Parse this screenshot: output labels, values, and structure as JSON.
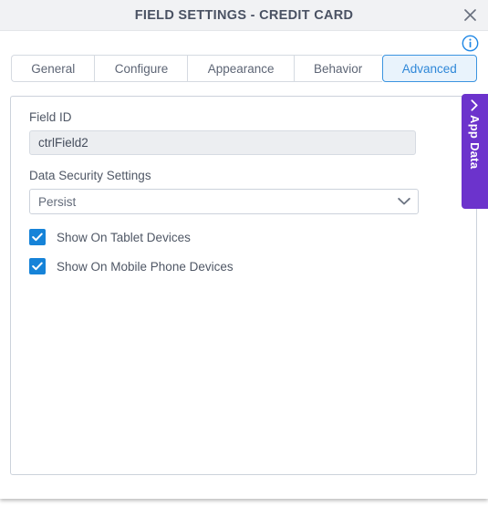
{
  "window": {
    "title": "FIELD SETTINGS - CREDIT CARD",
    "close_icon": "close-icon",
    "info_icon": "info-icon"
  },
  "tabs": [
    {
      "label": "General",
      "active": false
    },
    {
      "label": "Configure",
      "active": false
    },
    {
      "label": "Appearance",
      "active": false
    },
    {
      "label": "Behavior",
      "active": false
    },
    {
      "label": "Advanced",
      "active": true
    }
  ],
  "form": {
    "field_id": {
      "label": "Field ID",
      "value": "ctrlField2",
      "placeholder": ""
    },
    "data_security": {
      "label": "Data Security Settings",
      "value": "Persist",
      "caret_icon": "chevron-down-icon"
    },
    "checkboxes": [
      {
        "label": "Show On Tablet Devices",
        "checked": true
      },
      {
        "label": "Show On Mobile Phone Devices",
        "checked": true
      }
    ]
  },
  "side_panel": {
    "label": "App Data",
    "chevron_icon": "chevron-left-icon"
  },
  "colors": {
    "accent_blue": "#2e87d8",
    "checkbox_blue": "#1683d8",
    "app_data_purple": "#6c33cc",
    "titlebar_bg": "#f1f2f4",
    "title_text": "#4a5263"
  }
}
